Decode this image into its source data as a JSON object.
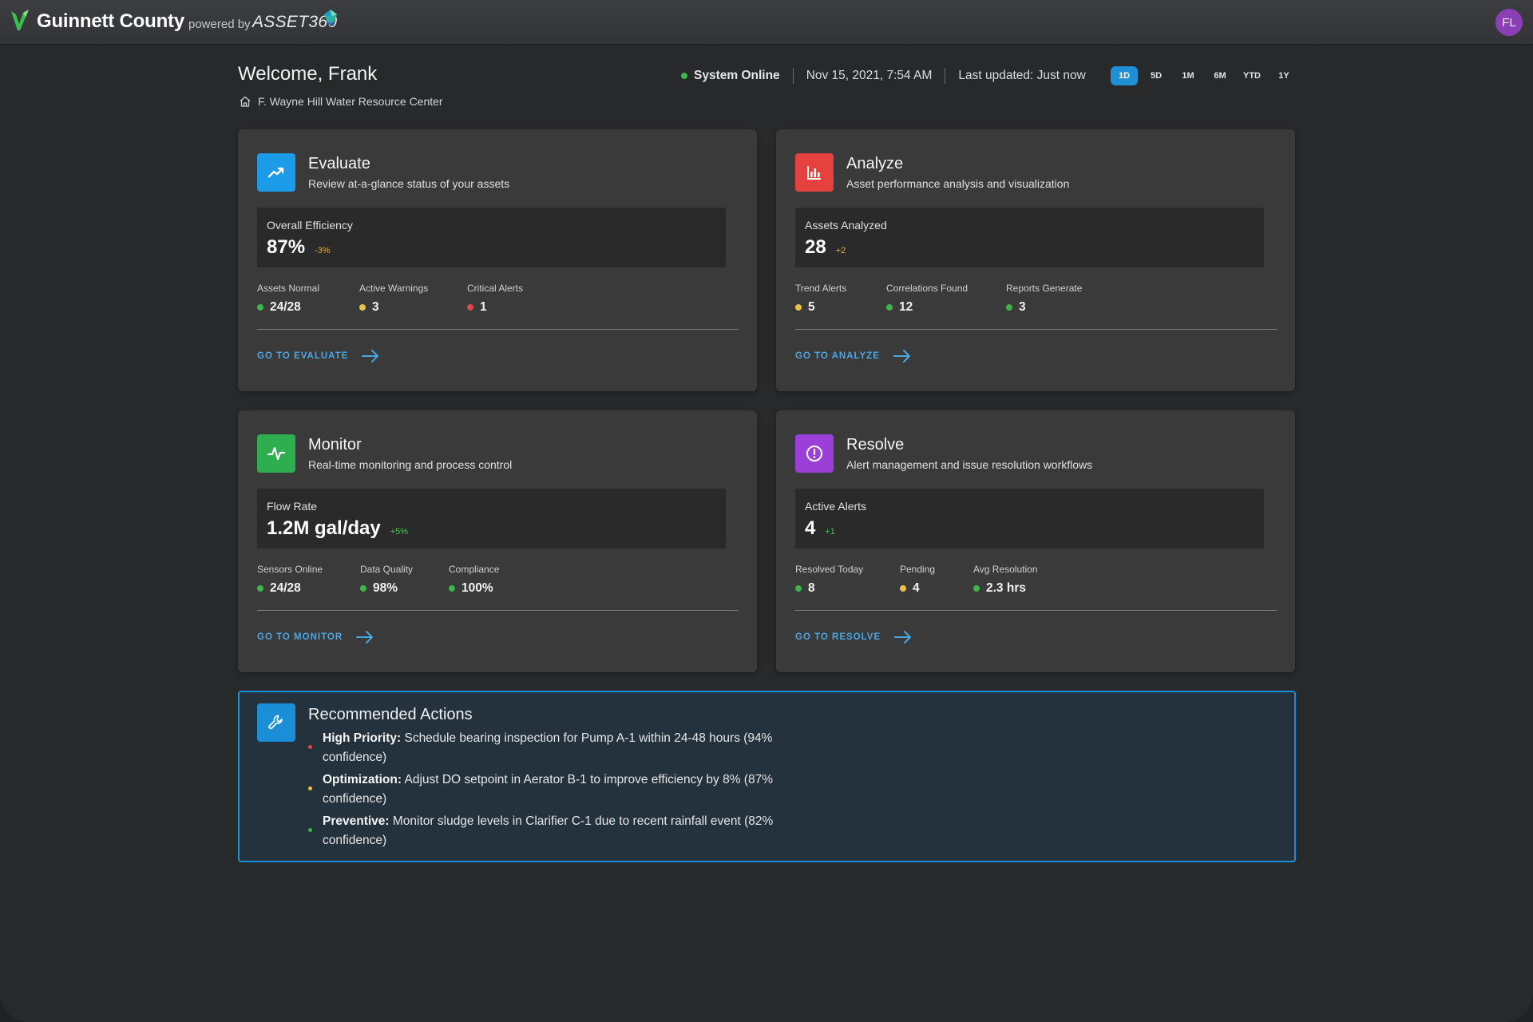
{
  "topbar": {
    "brand": "Guinnett County",
    "powered_by": "powered by",
    "product": "ASSET360",
    "avatar_initials": "FL"
  },
  "header": {
    "welcome": "Welcome, Frank",
    "facility": "F. Wayne Hill Water Resource Center",
    "status": "System Online",
    "datetime": "Nov 15, 2021, 7:54 AM",
    "last_updated": "Last updated: Just now",
    "ranges": [
      "1D",
      "5D",
      "1M",
      "6M",
      "YTD",
      "1Y"
    ],
    "active_range": "1D"
  },
  "cards": [
    {
      "title": "Evaluate",
      "subtitle": "Review at-a-glance status of your assets",
      "icon_color": "#1b9be8",
      "kpi_label": "Overall Efficiency",
      "kpi_value": "87%",
      "kpi_delta": "-3%",
      "stats": [
        {
          "label": "Assets Normal",
          "value": "24/28",
          "status": "green"
        },
        {
          "label": "Active Warnings",
          "value": "3",
          "status": "yellow"
        },
        {
          "label": "Critical Alerts",
          "value": "1",
          "status": "red"
        }
      ],
      "link": "GO TO EVALUATE"
    },
    {
      "title": "Analyze",
      "subtitle": "Asset performance analysis and visualization",
      "icon_color": "#e5413f",
      "kpi_label": "Assets Analyzed",
      "kpi_value": "28",
      "kpi_delta": "+2",
      "stats": [
        {
          "label": "Trend Alerts",
          "value": "5",
          "status": "yellow"
        },
        {
          "label": "Correlations Found",
          "value": "12",
          "status": "green"
        },
        {
          "label": "Reports Generate",
          "value": "3",
          "status": "green"
        }
      ],
      "link": "GO TO ANALYZE"
    },
    {
      "title": "Monitor",
      "subtitle": "Real-time monitoring and process control",
      "icon_color": "#2fae4f",
      "kpi_label": "Flow Rate",
      "kpi_value": "1.2M gal/day",
      "kpi_delta": "+5%",
      "stats": [
        {
          "label": "Sensors Online",
          "value": "24/28",
          "status": "green"
        },
        {
          "label": "Data Quality",
          "value": "98%",
          "status": "green"
        },
        {
          "label": "Compliance",
          "value": "100%",
          "status": "green"
        }
      ],
      "link": "GO TO MONITOR"
    },
    {
      "title": "Resolve",
      "subtitle": "Alert management and issue resolution workflows",
      "icon_color": "#9b3fd8",
      "kpi_label": "Active Alerts",
      "kpi_value": "4",
      "kpi_delta": "+1",
      "stats": [
        {
          "label": "Resolved Today",
          "value": "8",
          "status": "green"
        },
        {
          "label": "Pending",
          "value": "4",
          "status": "yellow"
        },
        {
          "label": "Avg Resolution",
          "value": "2.3 hrs",
          "status": "green"
        }
      ],
      "link": "GO TO RESOLVE"
    }
  ],
  "recommended": {
    "title": "Recommended Actions",
    "items": [
      {
        "priority": "High Priority:",
        "text": " Schedule bearing inspection for Pump A-1 within 24-48 hours (94% confidence)",
        "status": "red"
      },
      {
        "priority": "Optimization:",
        "text": " Adjust DO setpoint in Aerator B-1 to improve efficiency by 8% (87% confidence)",
        "status": "yellow"
      },
      {
        "priority": "Preventive:",
        "text": " Monitor sludge levels in Clarifier C-1 due to recent rainfall event (82% confidence)",
        "status": "green"
      }
    ]
  }
}
